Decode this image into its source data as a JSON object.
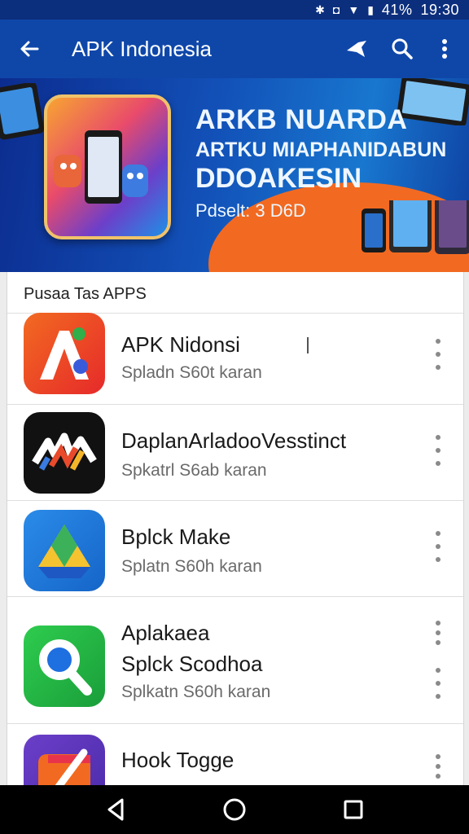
{
  "status_bar": {
    "battery": "41%",
    "time": "19:30"
  },
  "app_bar": {
    "title": "APK Indonesia"
  },
  "banner": {
    "headline1": "ARKB NUARDA",
    "headline2": "ARTKU MIAPHANIDABUN",
    "headline3": "DDOAKESIN",
    "subline": "Pdselt: 3 D6D"
  },
  "section": {
    "title": "Pusaa Tas APPS"
  },
  "apps": [
    {
      "name": "APK Nidonsi",
      "description": "Spladn S60t karan",
      "icon": "red-a-logo-icon"
    },
    {
      "name": "DaplanArladooVesstinct",
      "description": "Spkatrl S6ab karan",
      "icon": "colorful-wave-logo-icon"
    },
    {
      "name": "Bplck Make",
      "description": "Splatn S60h karan",
      "icon": "triangle-drive-logo-icon"
    },
    {
      "name": "Aplakaea",
      "name2": "Splck Scodhoa",
      "description": "Splkatn S60h karan",
      "icon": "magnifier-logo-icon"
    },
    {
      "name": "Hook Togge",
      "description": "",
      "icon": "purple-slash-logo-icon"
    }
  ],
  "icons": {
    "back": "arrow-back-icon",
    "share": "share-icon",
    "search": "search-icon",
    "overflow": "more-vert-icon"
  },
  "colors": {
    "status_bar": "#0c2f7d",
    "app_bar": "#0f47a9",
    "banner_accent": "#f26a21"
  }
}
